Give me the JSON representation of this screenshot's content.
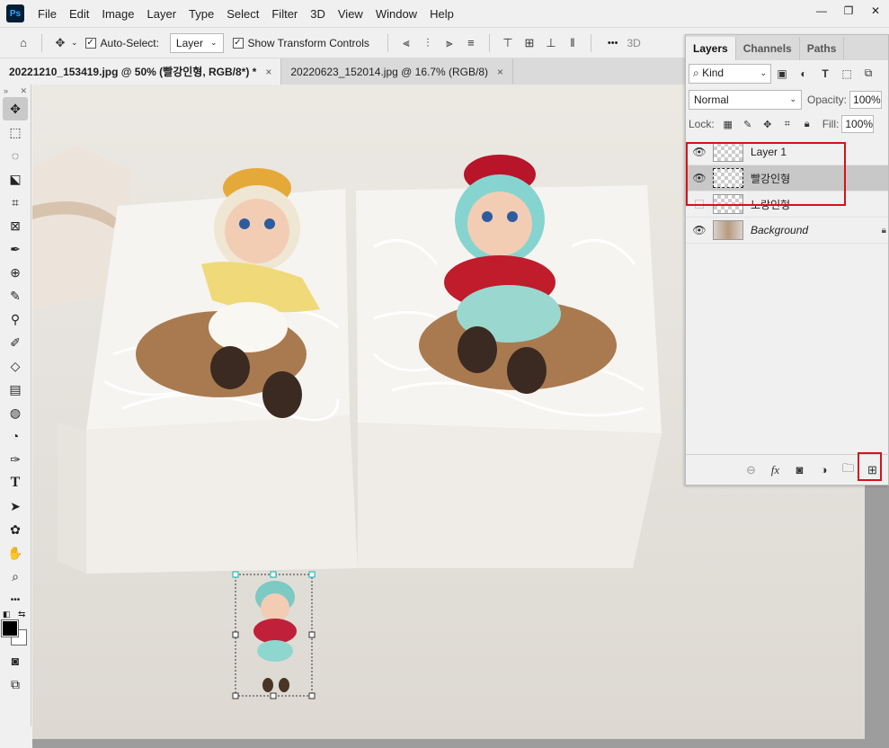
{
  "app": {
    "logo": "Ps"
  },
  "menu": [
    "File",
    "Edit",
    "Image",
    "Layer",
    "Type",
    "Select",
    "Filter",
    "3D",
    "View",
    "Window",
    "Help"
  ],
  "options": {
    "auto_select_label": "Auto-Select:",
    "auto_select_value": "Layer",
    "transform_label": "Show Transform Controls",
    "three_d": "3D",
    "more": "•••"
  },
  "tabs": [
    {
      "label": "20221210_153419.jpg @ 50% (빨강인형, RGB/8*) *",
      "close": "×"
    },
    {
      "label": "20220623_152014.jpg @ 16.7% (RGB/8)",
      "close": "×"
    }
  ],
  "layers_panel": {
    "tabs": [
      "Layers",
      "Channels",
      "Paths"
    ],
    "kind_label": "Kind",
    "blend_mode": "Normal",
    "opacity_label": "Opacity:",
    "opacity_value": "100%",
    "lock_label": "Lock:",
    "fill_label": "Fill:",
    "fill_value": "100%",
    "layers": [
      {
        "name": "Layer 1",
        "visible": true
      },
      {
        "name": "빨강인형",
        "visible": true,
        "selected": true
      },
      {
        "name": "노랑인형",
        "visible": false
      },
      {
        "name": "Background",
        "visible": true,
        "locked": true
      }
    ],
    "bottom_fx": "fx"
  },
  "colors": {
    "highlight": "#d9101a",
    "ps_blue": "#31a8ff"
  }
}
